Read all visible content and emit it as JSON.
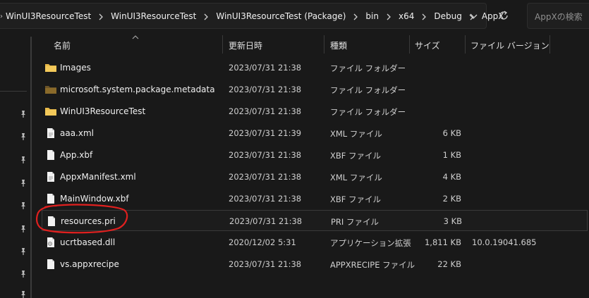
{
  "breadcrumb": [
    "WinUI3ResourceTest",
    "WinUI3ResourceTest",
    "WinUI3ResourceTest (Package)",
    "bin",
    "x64",
    "Debug",
    "AppX"
  ],
  "search": {
    "placeholder": "AppXの検索"
  },
  "columns": {
    "name": "名前",
    "date": "更新日時",
    "type": "種類",
    "size": "サイズ",
    "version": "ファイル バージョン"
  },
  "files": [
    {
      "name": "Images",
      "date": "2023/07/31 21:38",
      "type": "ファイル フォルダー",
      "size": "",
      "version": "",
      "icon": "folder-icon"
    },
    {
      "name": "microsoft.system.package.metadata",
      "date": "2023/07/31 21:38",
      "type": "ファイル フォルダー",
      "size": "",
      "version": "",
      "icon": "folder-icon"
    },
    {
      "name": "WinUI3ResourceTest",
      "date": "2023/07/31 21:38",
      "type": "ファイル フォルダー",
      "size": "",
      "version": "",
      "icon": "folder-icon"
    },
    {
      "name": "aaa.xml",
      "date": "2023/07/31 21:39",
      "type": "XML ファイル",
      "size": "6 KB",
      "version": "",
      "icon": "file-icon"
    },
    {
      "name": "App.xbf",
      "date": "2023/07/31 21:38",
      "type": "XBF ファイル",
      "size": "1 KB",
      "version": "",
      "icon": "file-icon"
    },
    {
      "name": "AppxManifest.xml",
      "date": "2023/07/31 21:38",
      "type": "XML ファイル",
      "size": "4 KB",
      "version": "",
      "icon": "file-icon"
    },
    {
      "name": "MainWindow.xbf",
      "date": "2023/07/31 21:38",
      "type": "XBF ファイル",
      "size": "2 KB",
      "version": "",
      "icon": "file-icon"
    },
    {
      "name": "resources.pri",
      "date": "2023/07/31 21:38",
      "type": "PRI ファイル",
      "size": "3 KB",
      "version": "",
      "icon": "file-icon"
    },
    {
      "name": "ucrtbased.dll",
      "date": "2020/12/02 5:31",
      "type": "アプリケーション拡張",
      "size": "1,811 KB",
      "version": "10.0.19041.685",
      "icon": "dll-icon"
    },
    {
      "name": "vs.appxrecipe",
      "date": "2023/07/31 21:38",
      "type": "APPXRECIPE ファイル",
      "size": "22 KB",
      "version": "",
      "icon": "file-icon"
    }
  ],
  "colors": {
    "folder": "#e8b949",
    "folder_dark": "#8a6a2a",
    "highlight_ring": "#e0201f"
  }
}
